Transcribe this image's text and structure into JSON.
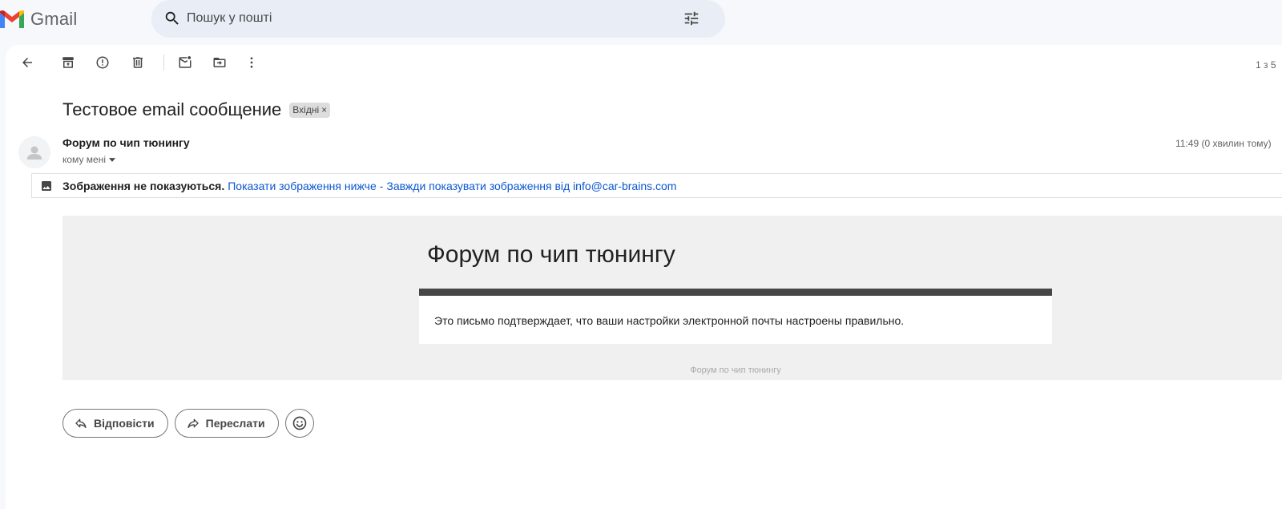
{
  "header": {
    "app_name": "Gmail",
    "search_placeholder": "Пошук у пошті"
  },
  "toolbar": {
    "icons": [
      "back-arrow-icon",
      "archive-icon",
      "report-spam-icon",
      "delete-icon",
      "mark-unread-icon",
      "move-to-icon",
      "more-vert-icon",
      "search-options-icon"
    ],
    "pager": "1 з 5"
  },
  "message": {
    "subject": "Тестовое email сообщение",
    "label": "Вхідні",
    "label_remove": "×",
    "sender_name": "Форум по чип тюнингу",
    "recipient": "кому мені",
    "timestamp": "11:49 (0 хвилин тому)"
  },
  "image_warning": {
    "bold_text": "Зображення не показуються.",
    "show_below": "Показати зображення нижче",
    "separator": "-",
    "always_show": "Завжди показувати зображення від info@car-brains.com"
  },
  "email_body": {
    "heading": "Форум по чип тюнингу",
    "text": "Это письмо подтверждает, что ваши настройки электронной почты настроены правильно.",
    "footer": "Форум по чип тюнингу"
  },
  "actions": {
    "reply": "Відповісти",
    "forward": "Переслати"
  },
  "colors": {
    "link": "#0b57d0",
    "search_bg": "#e9eef6",
    "page_bg": "#f6f8fc",
    "email_bar": "#464646"
  }
}
